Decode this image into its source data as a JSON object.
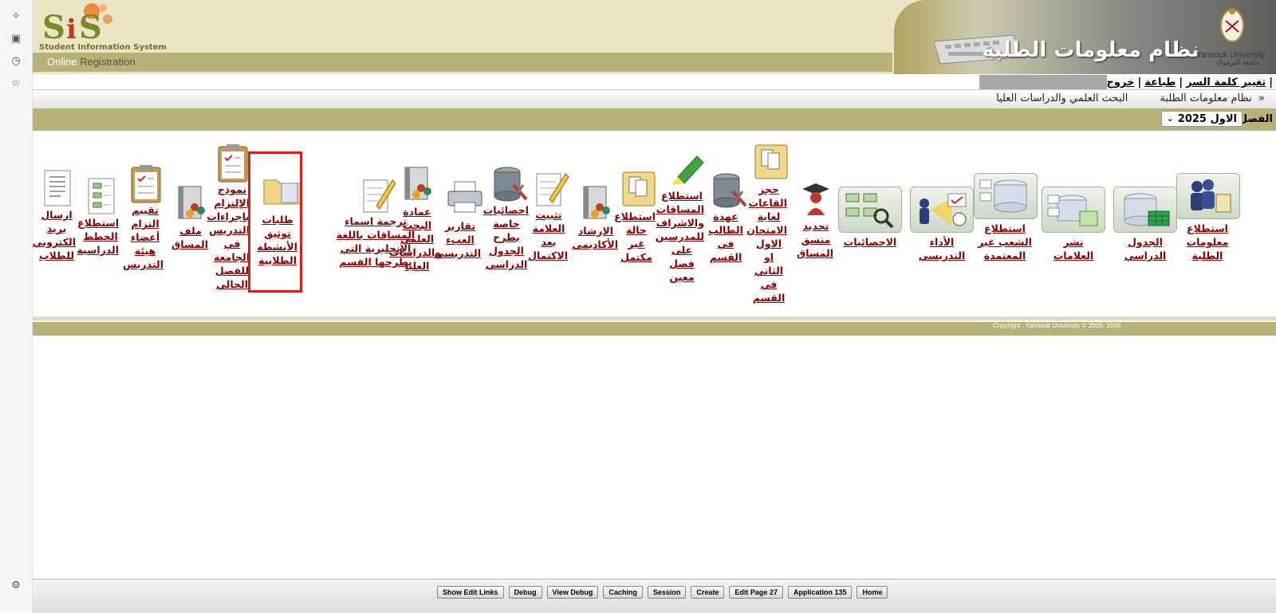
{
  "sidebar_icons": [
    "sparkle-icon",
    "save-icon",
    "history-icon",
    "star-icon",
    "settings-icon"
  ],
  "header": {
    "logo_line1": "Student Information System",
    "logo_online": "Online",
    "logo_registration": "Registration",
    "banner_title": "نظام معلومات الطلبة",
    "university_en": "Yarmouk University",
    "university_ar": "جامعة اليرموك"
  },
  "top_links": {
    "change_password": "تغيير كلمة السر",
    "print": "طباعة",
    "logout": "خروج",
    "sep": "|"
  },
  "nav": {
    "home_arrow": "«",
    "item1": "نظام معلومات الطلبة",
    "item2": "البحث العلمي والدراسات العليا"
  },
  "semester": {
    "label": "الفصل",
    "value": "الاول 2025"
  },
  "menu_tiles": [
    {
      "label": "استطلاع معلومات الطلبة",
      "icon": "people-scroll-icon"
    },
    {
      "label": "الجدول الدراسي",
      "icon": "database-table-icon"
    },
    {
      "label": "نشر العلامات",
      "icon": "database-cards-icon"
    },
    {
      "label": "استطلاع الشعب غير المعتمدة",
      "icon": "database-flow-icon"
    },
    {
      "label": "الأداء التدريسي",
      "icon": "teacher-chart-icon"
    },
    {
      "label": "الاحصائيات",
      "icon": "flowchart-search-icon"
    },
    {
      "label": "تحديد منسق المساق",
      "icon": "graduate-icon"
    },
    {
      "label": "حجز القاعات لغاية الامتحان الاول او الثاني في القسم",
      "icon": "documents-icon"
    },
    {
      "label": "عهدة الطالب في القسم",
      "icon": "database-tools-icon"
    },
    {
      "label": "استطلاع المساقات والاشراف للمدرسين على فصل معين",
      "icon": "highlighter-icon"
    },
    {
      "label": "استطلاع حالة غير مكتمل",
      "icon": "documents-icon"
    },
    {
      "label": "الإرشاد الأكاديمي",
      "icon": "binder-people-icon"
    },
    {
      "label": "تثبيت العلامة بعد الاكتمال",
      "icon": "pencil-paper-icon"
    },
    {
      "label": "احصائيات خاصة بطرح الجدول الدراسي",
      "icon": "database-tools-icon"
    },
    {
      "label": "تقارير العبء التدريسي",
      "icon": "printer-icon"
    },
    {
      "label": "عمادة البحث العلمي والدراسات العليا",
      "icon": "binder-people-icon"
    },
    {
      "label": "ترجمة اسماء المساقات باللغة الانجليزية التي يطرحها القسم",
      "icon": "pencil-paper-icon"
    },
    {
      "label": "طلبات توثيق الأنشطة الطلابية",
      "icon": "folder-icon"
    },
    {
      "label": "نموذج الإلتزام بإجراءات التدريس في الجامعة للفصل الحالي",
      "icon": "clipboard-check-icon"
    },
    {
      "label": "ملف المساق",
      "icon": "binder-people-icon"
    },
    {
      "label": "تقييم التزام أعضاء هيئة التدريس",
      "icon": "clipboard-check-icon"
    },
    {
      "label": "استطلاع الخطط الدراسية",
      "icon": "flowchart-doc-icon"
    },
    {
      "label": "ارسال بريد الكتروني للطلاب",
      "icon": "document-lines-icon"
    }
  ],
  "footer": {
    "copyright": "Copyright . Yarmouk University  ©   2005- 2008"
  },
  "dev_toolbar": [
    "Show Edit Links",
    "Debug",
    "View Debug",
    "Caching",
    "Session",
    "Create",
    "Edit Page 27",
    "Application 135",
    "Home"
  ],
  "colors": {
    "olive": "#b6b27a",
    "link_red": "#8b0000",
    "highlight": "#d92020"
  }
}
